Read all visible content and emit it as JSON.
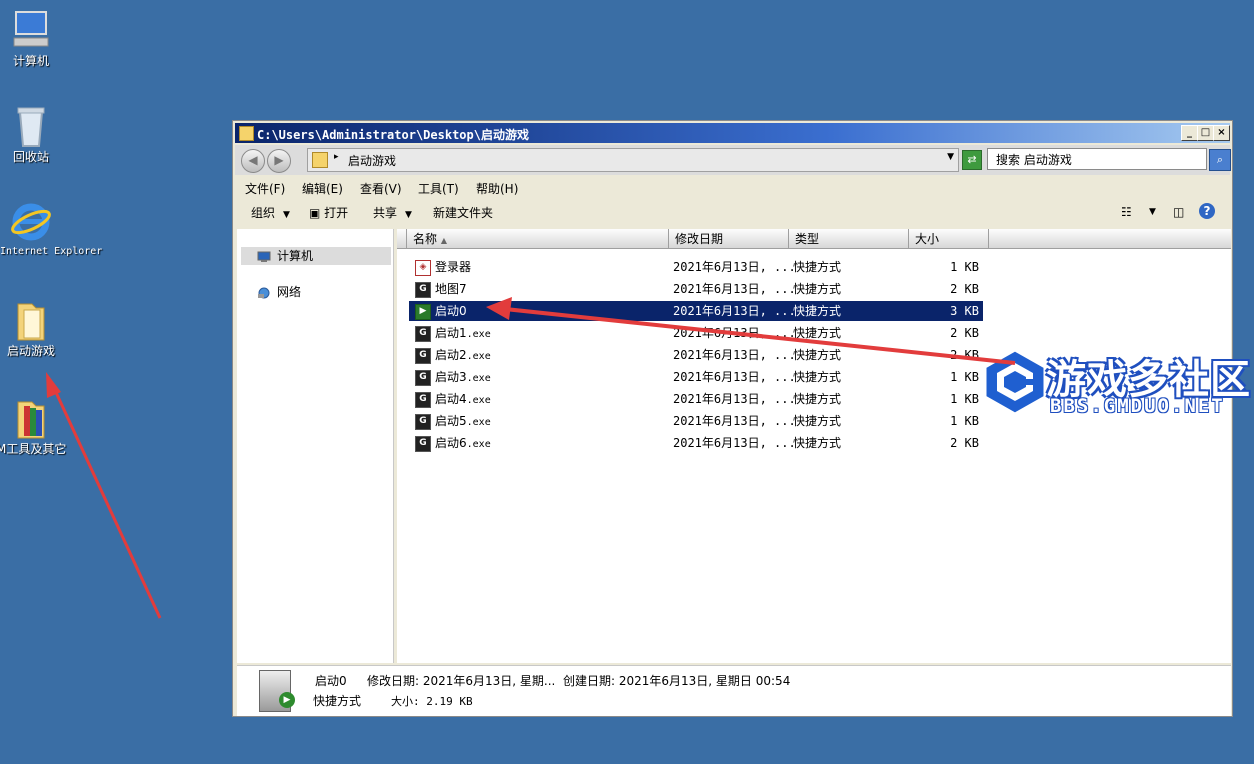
{
  "desktop": {
    "icons": [
      {
        "label": "计算机"
      },
      {
        "label": "回收站"
      },
      {
        "label": "Internet Explorer"
      },
      {
        "label": "启动游戏"
      },
      {
        "label": "M工具及其它"
      }
    ]
  },
  "window": {
    "title": "C:\\Users\\Administrator\\Desktop\\启动游戏",
    "caption": {
      "minimize": "_",
      "maximize": "□",
      "close": "×"
    },
    "address": {
      "path": "启动游戏"
    },
    "search": {
      "value": "搜索 启动游戏"
    },
    "menu": [
      "文件(F)",
      "编辑(E)",
      "查看(V)",
      "工具(T)",
      "帮助(H)"
    ],
    "toolbar": {
      "organize": "组织",
      "open": "打开",
      "share": "共享",
      "new_folder": "新建文件夹"
    },
    "nav": [
      {
        "label": "计算机",
        "selected": true
      },
      {
        "label": "网络",
        "selected": false
      }
    ],
    "columns": [
      "名称",
      "修改日期",
      "类型",
      "大小"
    ],
    "files": [
      {
        "name": "登录器",
        "ext": "",
        "date": "2021年6月13日, ...",
        "type": "快捷方式",
        "size": "1 KB",
        "icon": "launcher-icon"
      },
      {
        "name": "地图7",
        "ext": "",
        "date": "2021年6月13日, ...",
        "type": "快捷方式",
        "size": "2 KB",
        "icon": "game-icon"
      },
      {
        "name": "启动0",
        "ext": "",
        "date": "2021年6月13日, ...",
        "type": "快捷方式",
        "size": "3 KB",
        "icon": "start-icon"
      },
      {
        "name": "启动1",
        "ext": ".exe",
        "date": "2021年6月13日, ...",
        "type": "快捷方式",
        "size": "2 KB",
        "icon": "game-icon"
      },
      {
        "name": "启动2",
        "ext": ".exe",
        "date": "2021年6月13日, ...",
        "type": "快捷方式",
        "size": "2 KB",
        "icon": "game-icon"
      },
      {
        "name": "启动3",
        "ext": ".exe",
        "date": "2021年6月13日, ...",
        "type": "快捷方式",
        "size": "1 KB",
        "icon": "game-icon"
      },
      {
        "name": "启动4",
        "ext": ".exe",
        "date": "2021年6月13日, ...",
        "type": "快捷方式",
        "size": "1 KB",
        "icon": "game-icon"
      },
      {
        "name": "启动5",
        "ext": ".exe",
        "date": "2021年6月13日, ...",
        "type": "快捷方式",
        "size": "1 KB",
        "icon": "game-icon"
      },
      {
        "name": "启动6",
        "ext": ".exe",
        "date": "2021年6月13日, ...",
        "type": "快捷方式",
        "size": "2 KB",
        "icon": "game-icon"
      }
    ],
    "selected_index": 2,
    "details": {
      "name": "启动0",
      "modified": "修改日期: 2021年6月13日, 星期...",
      "created": "创建日期: 2021年6月13日, 星期日 00:54",
      "type": "快捷方式",
      "size": "大小: 2.19 KB"
    }
  },
  "watermark": {
    "title": "游戏多社区",
    "url": "BBS.GMDUO.NET"
  },
  "colors": {
    "desktop": "#3a6ea5",
    "selection": "#0a246a",
    "annotation_arrow": "#e23c3c"
  }
}
